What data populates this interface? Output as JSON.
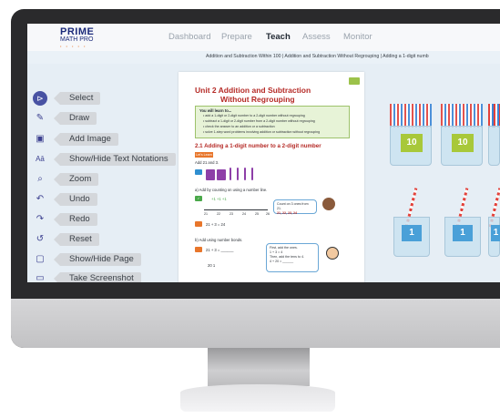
{
  "logo": {
    "line1": "PRIME",
    "line2": "MATH PRO",
    "line3": "• • • • •"
  },
  "nav": {
    "dashboard": "Dashboard",
    "prepare": "Prepare",
    "teach": "Teach",
    "assess": "Assess",
    "monitor": "Monitor"
  },
  "breadcrumb": "Addition and Subtraction Within 100  |  Addition and Subtraction Without Regrouping  |  Adding a 1-digit numb",
  "tools": [
    {
      "label": "Select",
      "icon": "select-arrow-icon",
      "glyph": "⊳"
    },
    {
      "label": "Draw",
      "icon": "pencil-icon",
      "glyph": "✎"
    },
    {
      "label": "Add Image",
      "icon": "image-icon",
      "glyph": "▣"
    },
    {
      "label": "Show/Hide Text Notations",
      "icon": "text-notation-icon",
      "glyph": "Aā"
    },
    {
      "label": "Zoom",
      "icon": "magnifier-icon",
      "glyph": "⌕"
    },
    {
      "label": "Undo",
      "icon": "undo-icon",
      "glyph": "↶"
    },
    {
      "label": "Redo",
      "icon": "redo-icon",
      "glyph": "↷"
    },
    {
      "label": "Reset",
      "icon": "reset-icon",
      "glyph": "↺"
    },
    {
      "label": "Show/Hide Page",
      "icon": "page-icon",
      "glyph": "▢"
    },
    {
      "label": "Take Screenshot",
      "icon": "screenshot-icon",
      "glyph": "▭"
    }
  ],
  "page": {
    "title1": "Unit 2  Addition and Subtraction",
    "title2": "Without Regrouping",
    "learn_title": "You will learn to...",
    "learn_lines": [
      "• add a 1-digit or 2-digit number to a 2-digit number without regrouping",
      "• subtract a 1-digit or 2-digit number from a 2-digit number without regrouping",
      "• check the answer to an addition or a subtraction",
      "• solve 1-step word problems involving addition or subtraction without regrouping"
    ],
    "section": "2.1  Adding a 1-digit number to a 2-digit number",
    "lets_learn": "Let's Learn",
    "add_line": "Add 21 and 3.",
    "q_a": "a)  Add by counting on using a number line.",
    "nl_ticks": [
      "21",
      "22",
      "23",
      "24",
      "25",
      "26"
    ],
    "nl_plus": "+1      +1      +1",
    "speech1": "Count on 3 ones from 21.",
    "speech1b": "21, 22, 23, 24",
    "eq1": "21 + 3 = 24",
    "q_b": "b)  Add using number bonds.",
    "eq2": "21 + 3 = ______",
    "bond": "20    1",
    "speech2a": "First, add the ones.",
    "speech2b": "1 + 3 = 4",
    "speech2c": "Then, add the tens to 4.",
    "speech2d": "4 + 20 = ______"
  },
  "cups": [
    {
      "label": "10"
    },
    {
      "label": "10"
    },
    {
      "label": "1"
    },
    {
      "label": "1"
    },
    {
      "label": "1"
    }
  ],
  "colors": {
    "brand_navy": "#1b2a7a",
    "title_red": "#b52a26",
    "active_tool": "#4852a3",
    "cup_label": "#4aa0d8"
  }
}
